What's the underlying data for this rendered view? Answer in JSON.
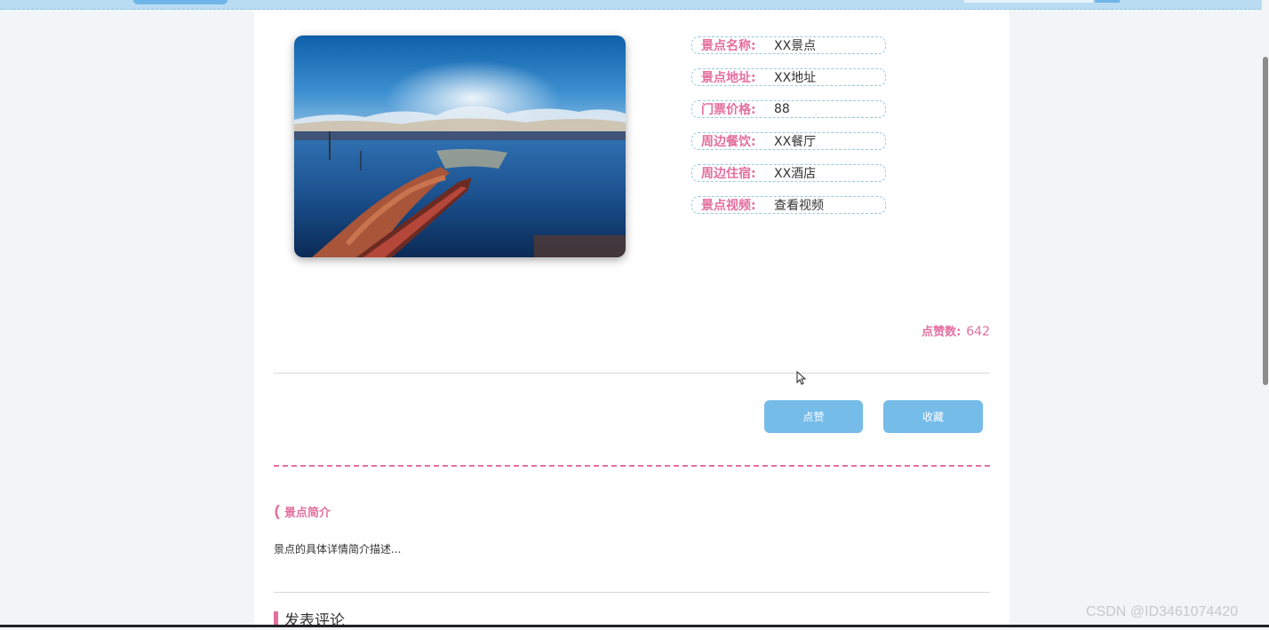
{
  "colors": {
    "accent_pink": "#e46f9f",
    "button_blue": "#76bce9",
    "header_blue": "#b9dcf2",
    "page_bg": "#f2f5f7"
  },
  "details": [
    {
      "label": "景点名称:",
      "value": "XX景点"
    },
    {
      "label": "景点地址:",
      "value": "XX地址"
    },
    {
      "label": "门票价格:",
      "value": "88"
    },
    {
      "label": "周边餐饮:",
      "value": "XX餐厅"
    },
    {
      "label": "周边住宿:",
      "value": "XX酒店"
    },
    {
      "label": "景点视频:",
      "value": "查看视频"
    }
  ],
  "likes": {
    "label": "点赞数:",
    "value": "642"
  },
  "actions": {
    "like_label": "点赞",
    "favorite_label": "收藏"
  },
  "intro": {
    "title": "景点简介",
    "text": "景点的具体详情简介描述..."
  },
  "comments": {
    "title": "发表评论"
  },
  "watermark": "CSDN @ID3461074420",
  "icons": {
    "section": "bracket-icon",
    "comment": "bar-icon",
    "cursor": "cursor-icon"
  }
}
